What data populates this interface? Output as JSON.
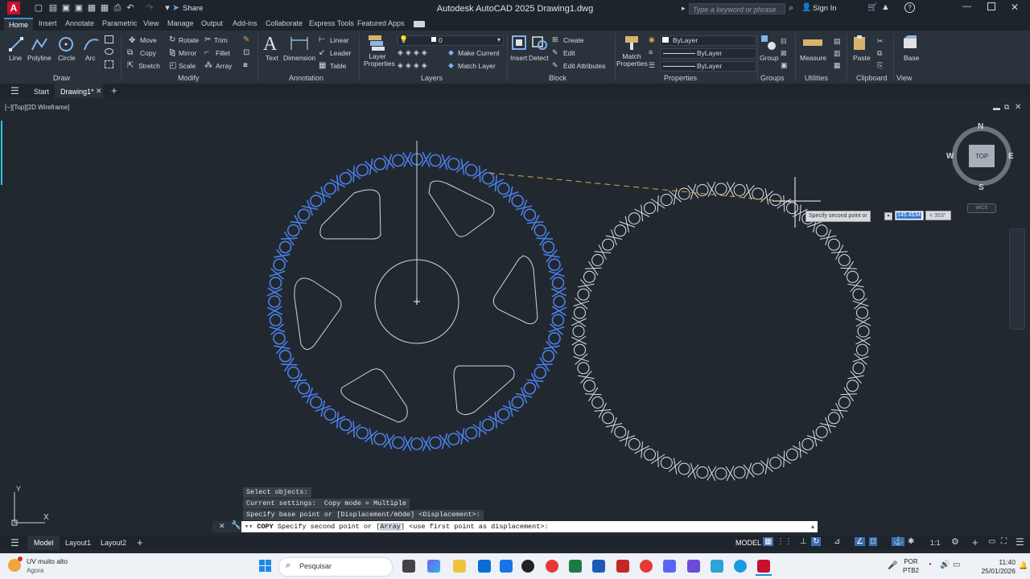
{
  "window": {
    "title": "Autodesk AutoCAD 2025   Drawing1.dwg",
    "app_logo": "A",
    "share_label": "Share",
    "search_placeholder": "Type a keyword or phrase",
    "signin_label": "Sign In"
  },
  "ribbon_tabs": [
    "Home",
    "Insert",
    "Annotate",
    "Parametric",
    "View",
    "Manage",
    "Output",
    "Add-ins",
    "Collaborate",
    "Express Tools",
    "Featured Apps"
  ],
  "ribbon": {
    "draw": {
      "title": "Draw",
      "line": "Line",
      "polyline": "Polyline",
      "circle": "Circle",
      "arc": "Arc"
    },
    "modify": {
      "title": "Modify",
      "move": "Move",
      "rotate": "Rotate",
      "trim": "Trim",
      "copy": "Copy",
      "mirror": "Mirror",
      "fillet": "Fillet",
      "stretch": "Stretch",
      "scale": "Scale",
      "array": "Array"
    },
    "annotation": {
      "title": "Annotation",
      "text": "Text",
      "dimension": "Dimension",
      "linear": "Linear",
      "leader": "Leader",
      "table": "Table"
    },
    "layers": {
      "title": "Layers",
      "layer_properties": "Layer\nProperties",
      "layer_value": "0",
      "make_current": "Make Current",
      "match_layer": "Match Layer"
    },
    "block": {
      "title": "Block",
      "insert": "Insert",
      "detect": "Detect",
      "create": "Create",
      "edit": "Edit",
      "edit_attributes": "Edit Attributes"
    },
    "properties": {
      "title": "Properties",
      "match_properties": "Match\nProperties",
      "bylayer_color": "ByLayer",
      "bylayer_linetype": "ByLayer",
      "bylayer_lineweight": "ByLayer"
    },
    "groups": {
      "title": "Groups",
      "group": "Group"
    },
    "utilities": {
      "title": "Utilities",
      "measure": "Measure"
    },
    "clipboard": {
      "title": "Clipboard",
      "paste": "Paste"
    },
    "view": {
      "title": "View",
      "base": "Base"
    }
  },
  "file_tabs": {
    "start": "Start",
    "drawing": "Drawing1*"
  },
  "viewport": {
    "label": "[−][Top][2D Wireframe]",
    "viewcube": {
      "n": "N",
      "s": "S",
      "e": "E",
      "w": "W",
      "top": "TOP",
      "wcs": "WCS"
    },
    "tooltip": {
      "prompt": "Specify second point or",
      "distance": "145.4534",
      "angle": "< 353°"
    },
    "ucs": {
      "x": "X",
      "y": "Y"
    }
  },
  "command": {
    "history": [
      "Select objects:",
      "Current settings:  Copy mode = Multiple",
      "Specify base point or [Displacement/mOde] <Displacement>:"
    ],
    "prompt_name": "COPY",
    "prompt_pre": "Specify second point or [",
    "prompt_option": "Array",
    "prompt_post": "] <use first point as displacement>:"
  },
  "layout_tabs": {
    "model": "Model",
    "layout1": "Layout1",
    "layout2": "Layout2"
  },
  "status": {
    "model": "MODEL",
    "scale": "1:1"
  },
  "taskbar": {
    "weather": "UV muito alto",
    "weather_sub": "Agora",
    "search": "Pesquisar",
    "lang": "POR",
    "lang_sub": "PTB2",
    "time": "11:40",
    "date": "25/01/2026"
  },
  "colors": {
    "selected": "#4c7fe6",
    "accent": "#3b8ed8",
    "canvas": "#212830",
    "autocad_red": "#c8102e"
  }
}
